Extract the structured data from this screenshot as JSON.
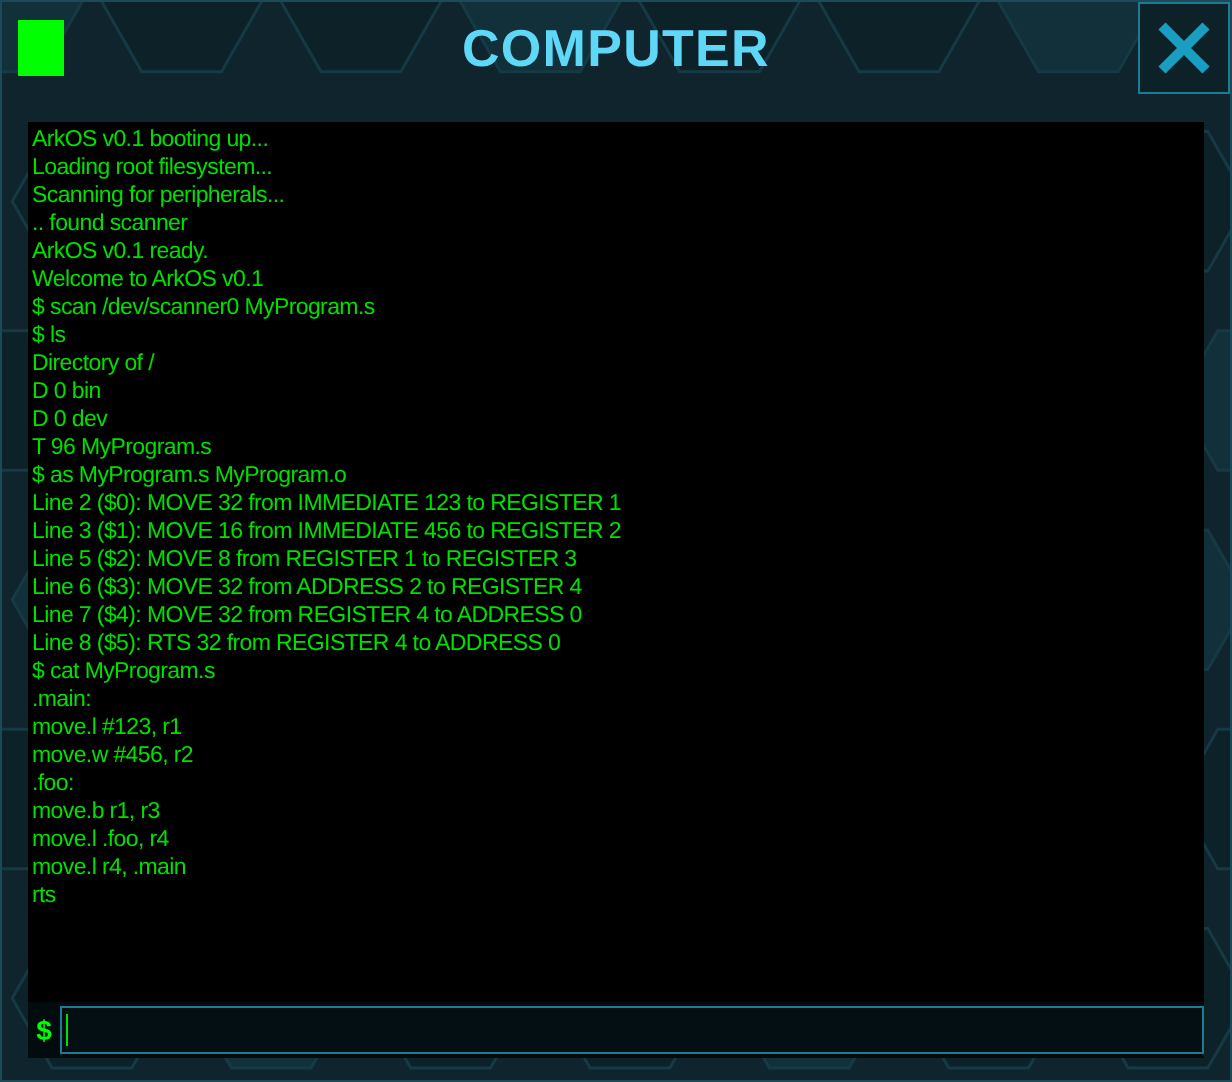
{
  "window": {
    "title": "COMPUTER"
  },
  "terminal": {
    "lines": [
      "ArkOS v0.1 booting up...",
      "Loading root filesystem...",
      "Scanning for peripherals...",
      ".. found scanner",
      "ArkOS v0.1 ready.",
      "Welcome to ArkOS v0.1",
      "$ scan /dev/scanner0 MyProgram.s",
      "$ ls",
      "Directory of /",
      "D 0 bin",
      "D 0 dev",
      "T 96 MyProgram.s",
      "$ as MyProgram.s MyProgram.o",
      "Line 2 ($0): MOVE 32 from IMMEDIATE 123 to REGISTER 1",
      "Line 3 ($1): MOVE 16 from IMMEDIATE 456 to REGISTER 2",
      "Line 5 ($2): MOVE 8 from REGISTER 1 to REGISTER 3",
      "Line 6 ($3): MOVE 32 from ADDRESS 2 to REGISTER 4",
      "Line 7 ($4): MOVE 32 from REGISTER 4 to ADDRESS 0",
      "Line 8 ($5): RTS 32 from REGISTER 4 to ADDRESS 0",
      "$ cat MyProgram.s",
      ".main:",
      "move.l #123, r1",
      "move.w #456, r2",
      ".foo:",
      "move.b r1, r3",
      "move.l .foo, r4",
      "move.l r4, .main",
      "rts"
    ]
  },
  "prompt": {
    "symbol": "$"
  }
}
